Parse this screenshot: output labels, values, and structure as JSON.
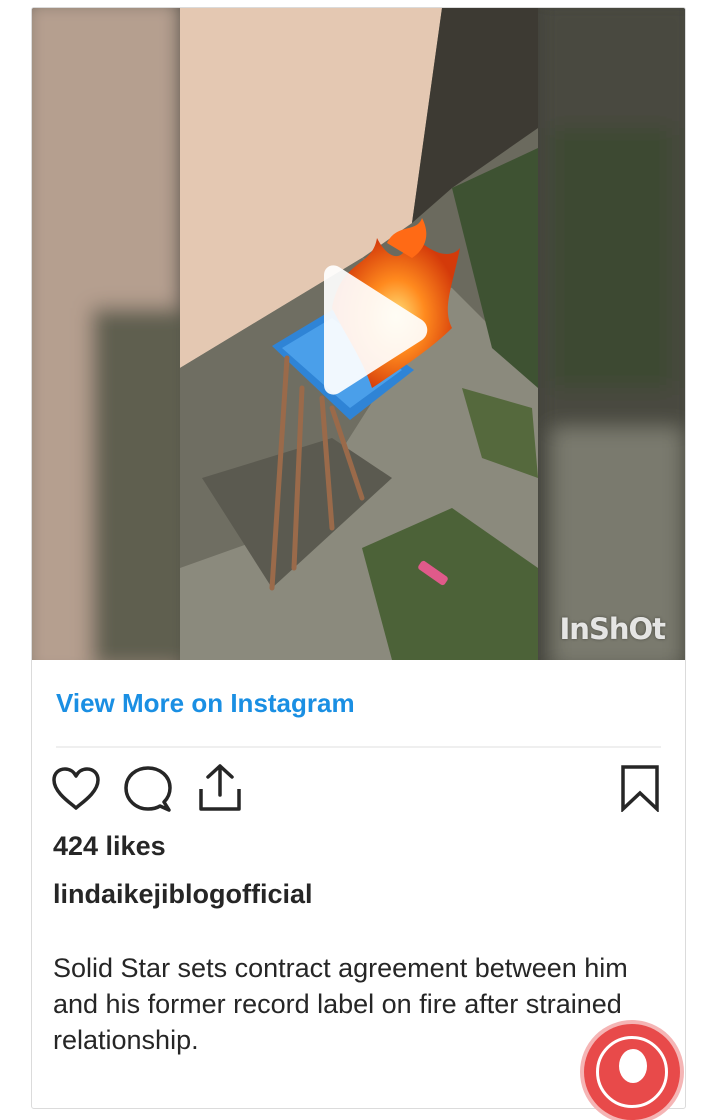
{
  "post": {
    "video": {
      "watermark": "InShOt",
      "play_icon": "play-icon"
    },
    "view_more_label": "View More on Instagram",
    "actions": {
      "like_icon": "heart-icon",
      "comment_icon": "comment-icon",
      "share_icon": "share-icon",
      "save_icon": "bookmark-icon"
    },
    "likes": "424 likes",
    "username": "lindaikejiblogofficial",
    "caption": "Solid Star sets contract agreement between him and his former record label on fire after strained relationship."
  },
  "floating_button": {
    "icon": "user-icon",
    "color": "#e84a4a"
  },
  "colors": {
    "link": "#1a8fe3",
    "text": "#262626",
    "border": "#dbdbdb"
  }
}
